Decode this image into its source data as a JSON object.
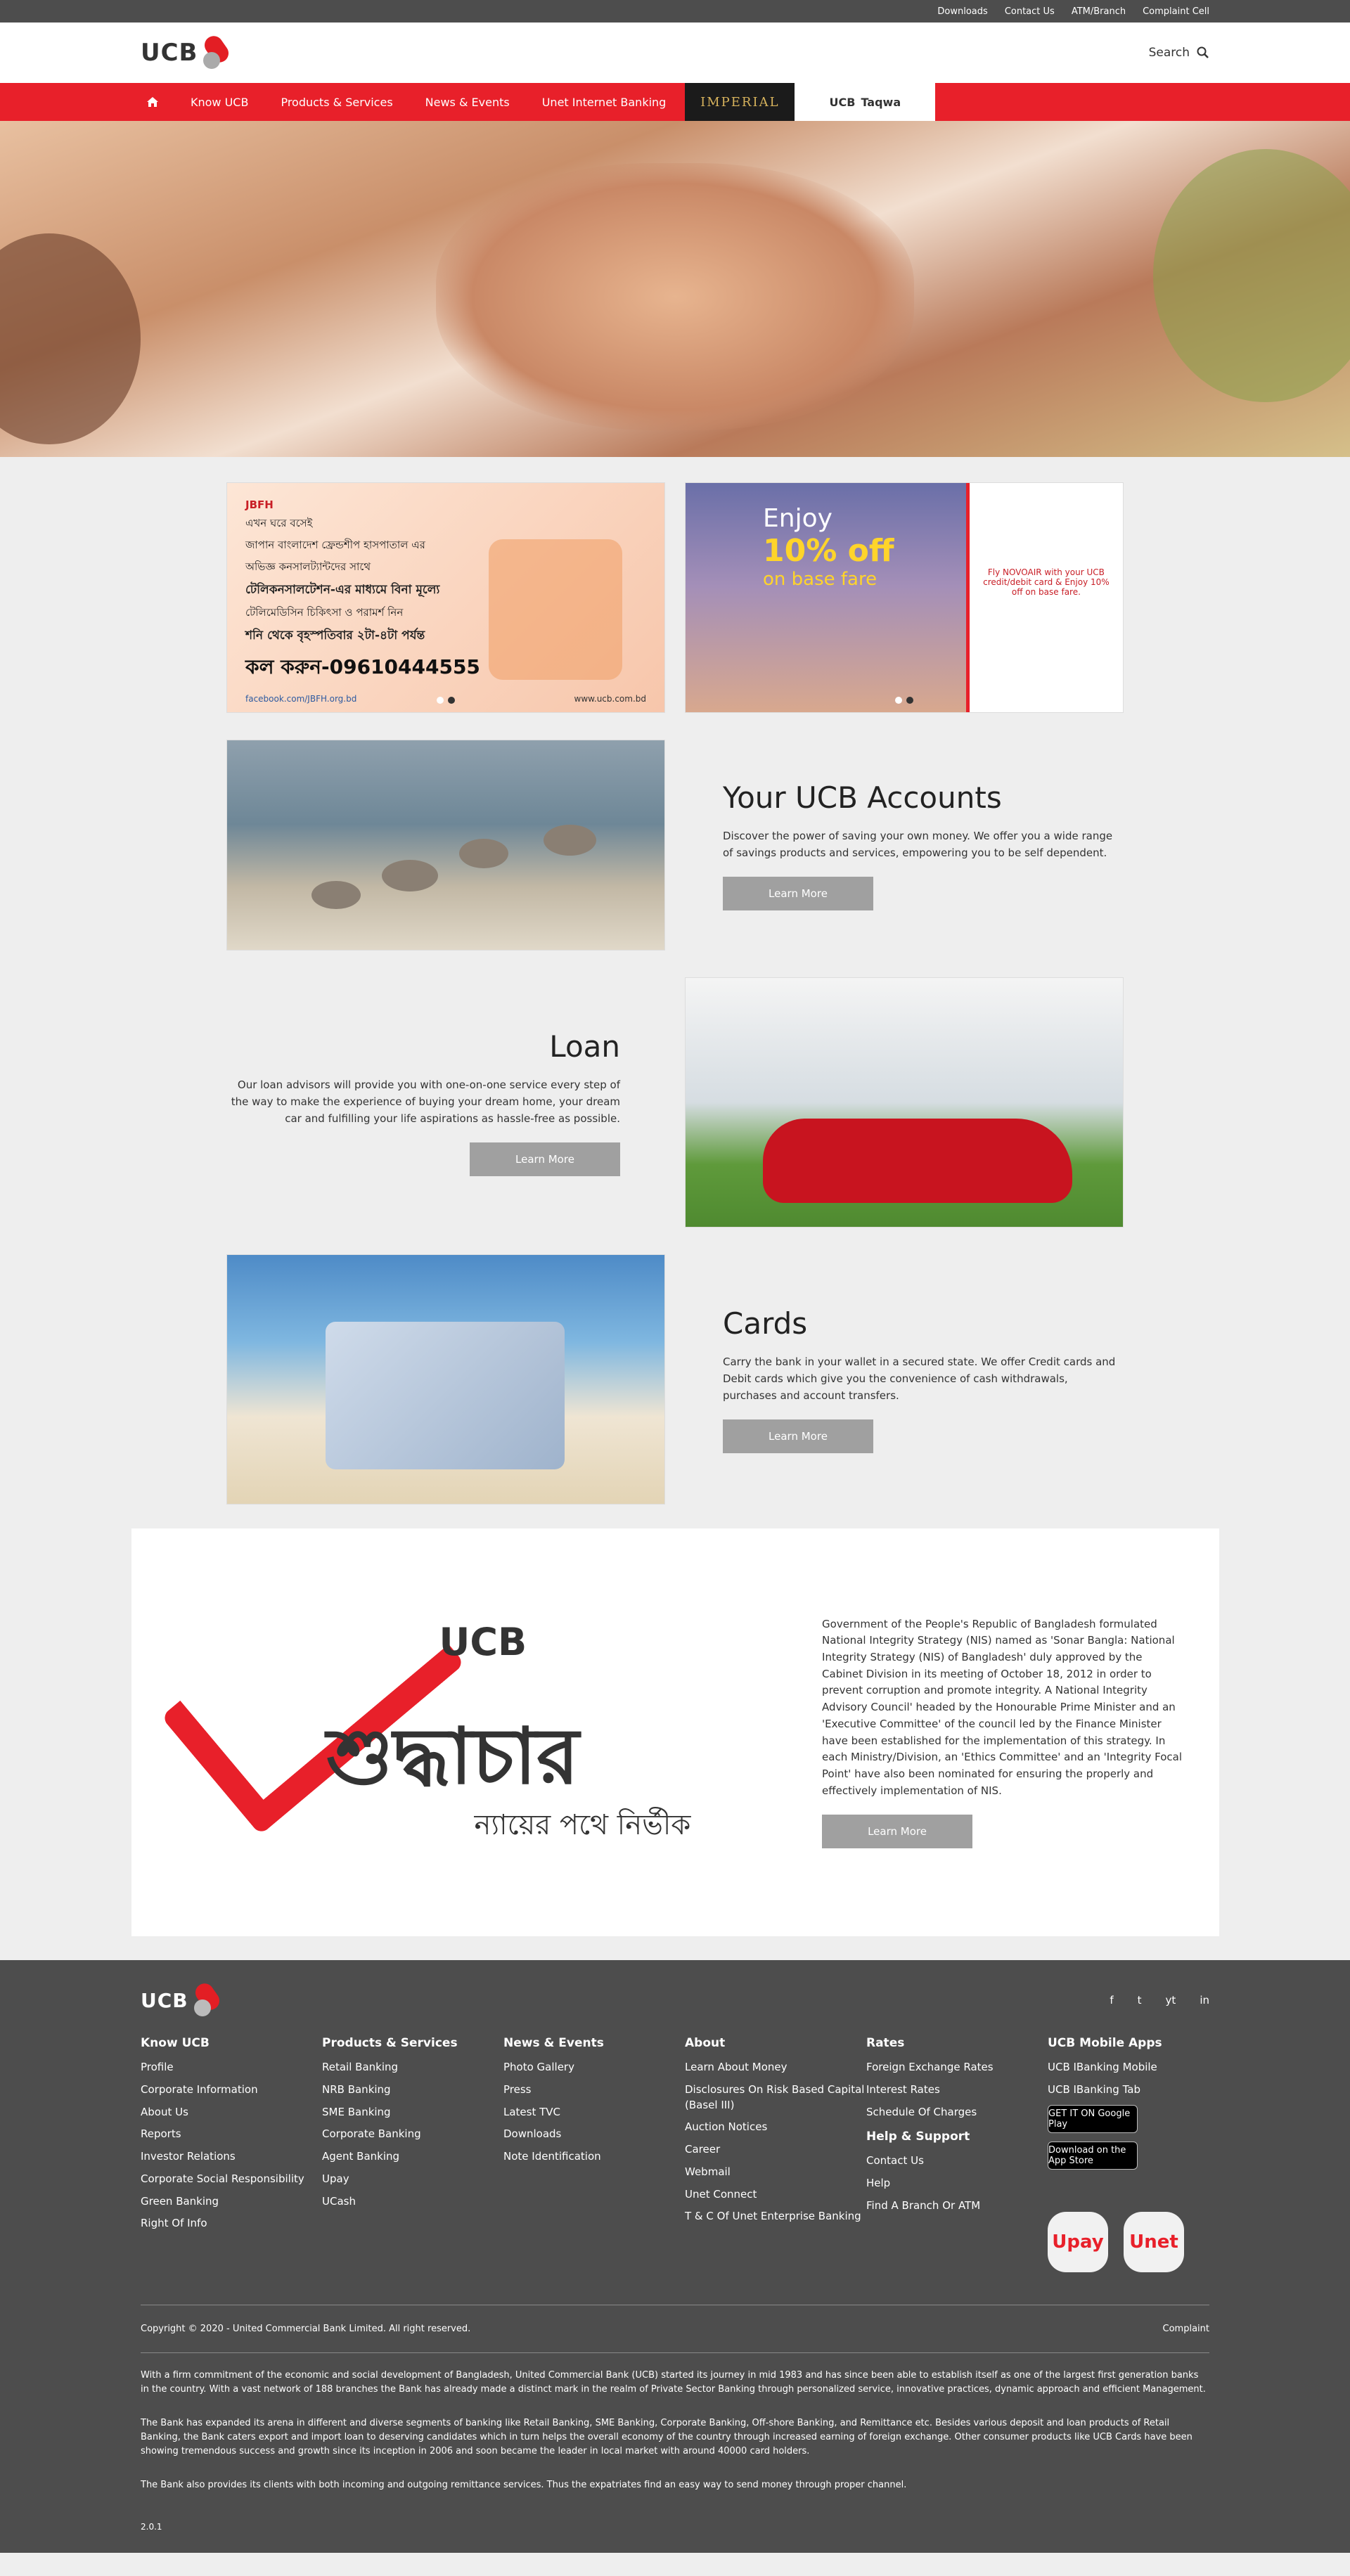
{
  "topbar": {
    "links": [
      "Downloads",
      "Contact Us",
      "ATM/Branch",
      "Complaint Cell"
    ]
  },
  "header": {
    "logo": "UCB",
    "search": "Search"
  },
  "nav": {
    "items": [
      "Know UCB",
      "Products & Services",
      "News & Events",
      "Unet Internet Banking"
    ],
    "imperial": "IMPERIAL",
    "taqwa": "Taqwa"
  },
  "banners": {
    "jbfh": {
      "org": "JBFH",
      "lines": [
        "এখন ঘরে বসেই",
        "জাপান বাংলাদেশ ফ্রেন্ডশীপ হাসপাতাল এর",
        "অভিজ্ঞ কনসালট্যান্টদের সাথে",
        "টেলিকনসালটেশন-এর মাধ্যমে বিনা মূল্যে",
        "টেলিমেডিসিন চিকিৎসা ও পরামর্শ নিন",
        "শনি থেকে বৃহস্পতিবার ২টা-৪টা পর্যন্ত"
      ],
      "phone": "কল করুন-09610444555",
      "facebook": "facebook.com/JBFH.org.bd",
      "web": "www.ucb.com.bd"
    },
    "novoair": {
      "enjoy": "Enjoy",
      "off": "10% off",
      "base": "on base fare",
      "right": "Fly NOVOAIR with your UCB credit/debit card & Enjoy 10% off on base fare."
    }
  },
  "features": [
    {
      "title": "Your UCB Accounts",
      "text": "Discover the power of saving your own money. We offer you a wide range of savings products and services, empowering you to be self dependent.",
      "button": "Learn More"
    },
    {
      "title": "Loan",
      "text": "Our loan advisors will provide you with one-on-one service every step of the way to make the experience of buying your dream home, your dream car and fulfilling your life aspirations as hassle-free as possible.",
      "button": "Learn More"
    },
    {
      "title": "Cards",
      "text": "Carry the bank in your wallet in a secured state. We offer Credit cards and Debit cards which give you the convenience of cash withdrawals, purchases and account transfers.",
      "button": "Learn More"
    }
  ],
  "integrity": {
    "logo_ucb": "UCB",
    "logo_bangla": "শুদ্ধাচার",
    "logo_sub": "ন্যায়ের পথে নির্ভীক",
    "text": "Government of the People's Republic of Bangladesh formulated National Integrity Strategy (NIS) named as 'Sonar Bangla: National Integrity Strategy (NIS) of Bangladesh' duly approved by the Cabinet Division in its meeting of October 18, 2012 in order to prevent corruption and promote integrity. A National Integrity Advisory Council' headed by the Honourable Prime Minister and an 'Executive Committee' of the council led by the Finance Minister have been established for the implementation of this strategy. In each Ministry/Division, an 'Ethics Committee' and an 'Integrity Focal Point' have also been nominated for ensuring the properly and effectively implementation of NIS.",
    "button": "Learn More"
  },
  "footer": {
    "logo": "UCB",
    "social": [
      "f",
      "t",
      "yt",
      "in"
    ],
    "cols": [
      {
        "title": "Know UCB",
        "links": [
          "Profile",
          "Corporate Information",
          "About Us",
          "Reports",
          "Investor Relations",
          "Corporate Social Responsibility",
          "Green Banking",
          "Right Of Info"
        ]
      },
      {
        "title": "Products & Services",
        "links": [
          "Retail Banking",
          "NRB Banking",
          "SME Banking",
          "Corporate Banking",
          "Agent Banking",
          "Upay",
          "UCash"
        ]
      },
      {
        "title": "News & Events",
        "links": [
          "Photo Gallery",
          "Press",
          "Latest TVC",
          "Downloads",
          "Note Identification"
        ]
      },
      {
        "title": "About",
        "links": [
          "Learn About Money",
          "Disclosures On Risk Based Capital (Basel III)",
          "Auction Notices",
          "Career",
          "Webmail",
          "Unet Connect",
          "T & C Of Unet Enterprise Banking"
        ]
      },
      {
        "title": "Rates",
        "links": [
          "Foreign Exchange Rates",
          "Interest Rates",
          "Schedule Of Charges"
        ],
        "title2": "Help & Support",
        "links2": [
          "Contact Us",
          "Help",
          "Find A Branch Or ATM"
        ]
      },
      {
        "title": "UCB Mobile Apps",
        "links": [
          "UCB IBanking Mobile",
          "UCB IBanking Tab"
        ],
        "stores": [
          "GET IT ON Google Play",
          "Download on the App Store"
        ],
        "apps": [
          "Upay",
          "Unet"
        ]
      }
    ],
    "copyright": "Copyright © 2020 - United Commercial Bank Limited.  All right reserved.",
    "complaint": "Complaint",
    "about": [
      "With a firm commitment of the economic and social development of Bangladesh, United Commercial Bank (UCB) started its journey in mid 1983 and has since been able to establish itself as one of the largest first generation banks in the country. With a vast network of 188 branches the Bank has already made a distinct mark in the realm of Private Sector Banking through personalized service, innovative practices, dynamic approach and efficient Management.",
      "The Bank has expanded its arena in different and diverse segments of banking like Retail Banking, SME Banking, Corporate Banking, Off-shore Banking, and Remittance etc. Besides various deposit and loan products of Retail Banking, the Bank caters export and import loan to deserving candidates which in turn helps the overall economy of the country through increased earning of foreign exchange. Other consumer products like UCB Cards have been showing tremendous success and growth since its inception in 2006 and soon became the leader in local market with around 40000 card holders.",
      "The Bank also provides its clients with both incoming and outgoing remittance services. Thus the expatriates find an easy way to send money through proper channel."
    ],
    "version": "2.0.1"
  }
}
